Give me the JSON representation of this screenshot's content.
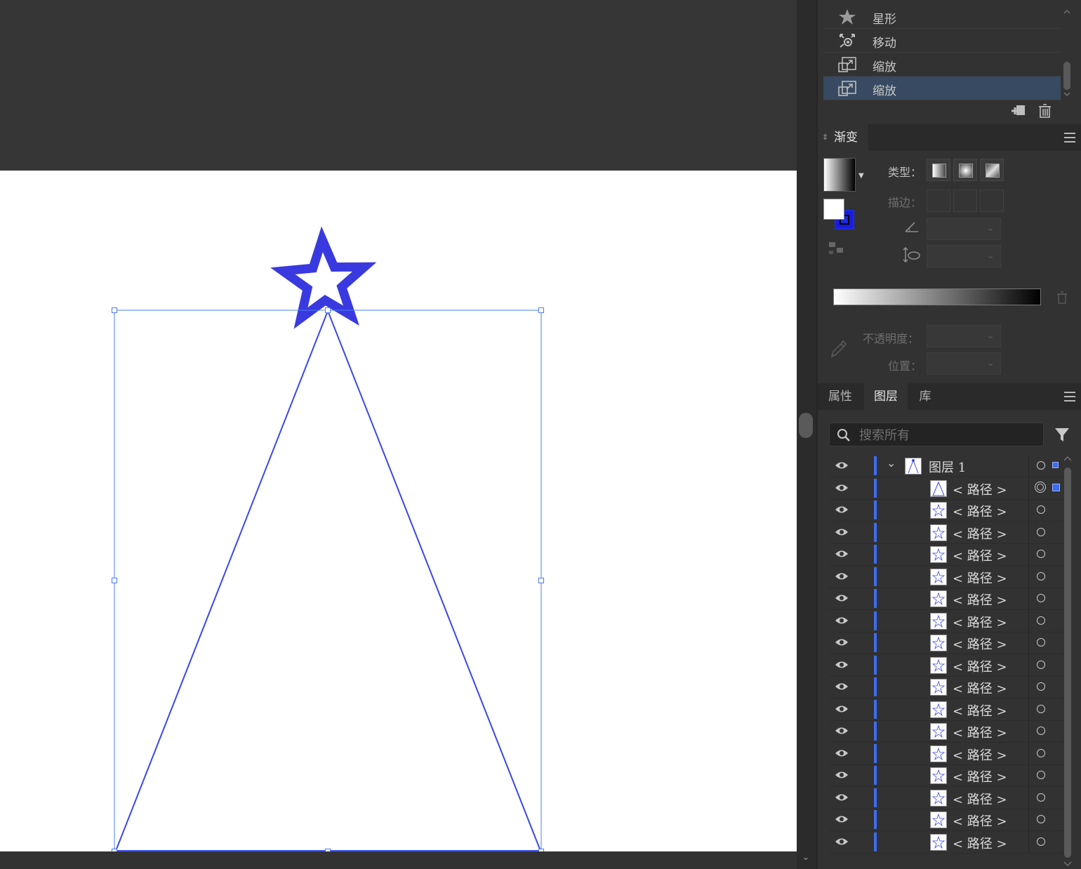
{
  "actions": {
    "items": [
      {
        "label": "星形",
        "icon": "star-icon"
      },
      {
        "label": "移动",
        "icon": "move-icon"
      },
      {
        "label": "缩放",
        "icon": "scale-icon"
      },
      {
        "label": "缩放",
        "icon": "scale-icon",
        "selected": true
      }
    ]
  },
  "gradient": {
    "title": "渐变",
    "type_label": "类型：",
    "stroke_label": "描边：",
    "opacity_label": "不透明度：",
    "location_label": "位置："
  },
  "layers_panel": {
    "tabs": [
      "属性",
      "图层",
      "库"
    ],
    "active_tab": "图层",
    "search_placeholder": "搜索所有",
    "layer_name": "图层  1",
    "path_label": "< 路径 >",
    "path_count": 17
  },
  "colors": {
    "accent": "#3d6cf0",
    "star": "#3a3ae0",
    "selection": "#374a61"
  }
}
